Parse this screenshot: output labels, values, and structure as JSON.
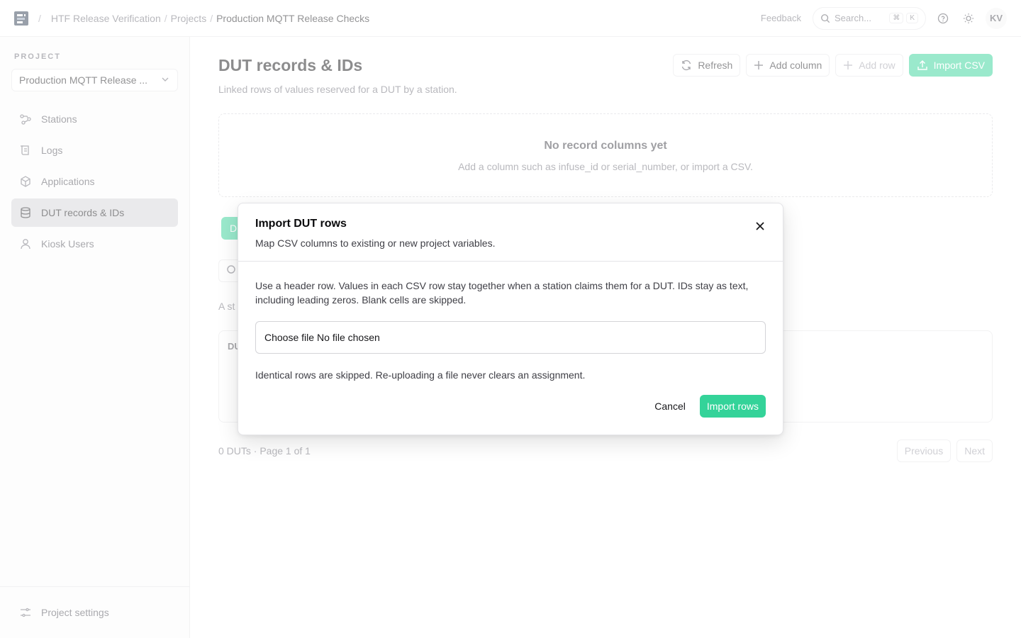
{
  "header": {
    "breadcrumbs": [
      "HTF Release Verification",
      "Projects",
      "Production MQTT Release Checks"
    ],
    "breadcrumb_separator": "/",
    "feedback_label": "Feedback",
    "search_placeholder": "Search...",
    "search_shortcut": [
      "⌘",
      "K"
    ],
    "avatar_initials": "KV"
  },
  "sidebar": {
    "project_label": "PROJECT",
    "project_selected": "Production MQTT Release ...",
    "items": [
      {
        "label": "Stations",
        "icon": "stations-icon"
      },
      {
        "label": "Logs",
        "icon": "logs-icon"
      },
      {
        "label": "Applications",
        "icon": "package-icon"
      },
      {
        "label": "DUT records & IDs",
        "icon": "database-icon",
        "active": true
      },
      {
        "label": "Kiosk Users",
        "icon": "user-icon"
      }
    ],
    "footer_item": "Project settings"
  },
  "main": {
    "title": "DUT records & IDs",
    "subtitle": "Linked rows of values reserved for a DUT by a station.",
    "actions": {
      "refresh": "Refresh",
      "add_column": "Add column",
      "add_row": "Add row",
      "import_csv": "Import CSV"
    },
    "empty_title": "No record columns yet",
    "empty_subtitle": "Add a column such as infuse_id or serial_number, or import a CSV.",
    "tab_partial": "D",
    "status_partial": "A st",
    "table_header_partial": "DU",
    "pager_info": "0 DUTs · Page 1 of 1",
    "previous": "Previous",
    "next": "Next"
  },
  "modal": {
    "title": "Import DUT rows",
    "subtitle": "Map CSV columns to existing or new project variables.",
    "description": "Use a header row. Values in each CSV row stay together when a station claims them for a DUT. IDs stay as text, including leading zeros. Blank cells are skipped.",
    "file_button": "Choose file",
    "file_status": "No file chosen",
    "note": "Identical rows are skipped. Re-uploading a file never clears an assignment.",
    "cancel": "Cancel",
    "import": "Import rows"
  },
  "colors": {
    "accent": "#34d399",
    "active_nav": "#d4d4d8"
  }
}
